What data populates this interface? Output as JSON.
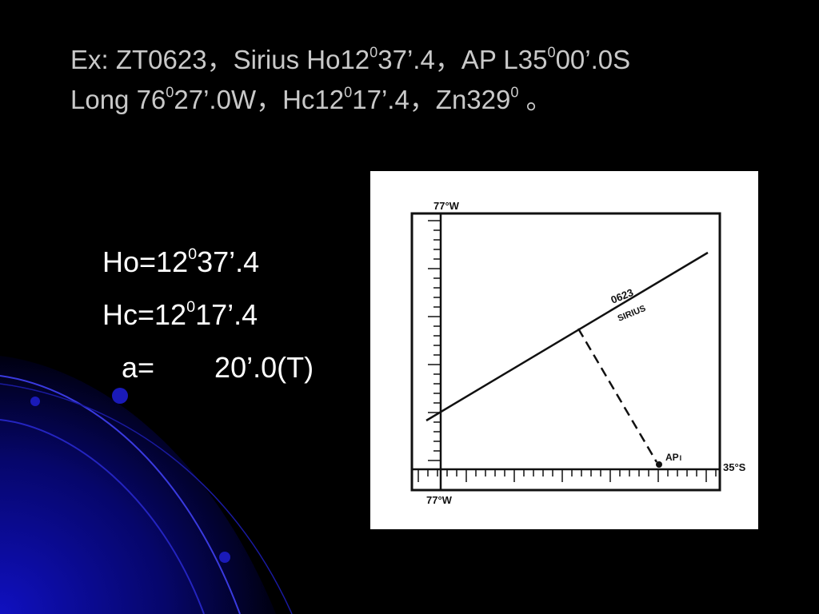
{
  "title": {
    "line1": {
      "t1": "Ex: ZT0623，Sirius Ho12",
      "s1": "0",
      "t2": "37’.4，AP L35",
      "s2": "0",
      "t3": "00’.0S"
    },
    "line2": {
      "t1": "Long 76",
      "s1": "0",
      "t2": "27’.0W，Hc12",
      "s2": "0",
      "t3": "17’.4，Zn329",
      "s3": "0",
      "t4": " 。"
    }
  },
  "equations": {
    "ho": {
      "label": "Ho=",
      "deg": "12",
      "sup": "0",
      "min": "37’.4"
    },
    "hc": {
      "label": "Hc=",
      "deg": "12",
      "sup": "0",
      "min": "17’.4"
    },
    "a": {
      "label": "a=",
      "value": "20’.0(T)"
    }
  },
  "diagram": {
    "top_label": "77°W",
    "bottom_label": "77°W",
    "right_label": "35°S",
    "lop_time": "0623",
    "lop_body": "SIRIUS",
    "ap_label": "AP",
    "ap_sub": "I"
  },
  "colors": {
    "background": "#000000",
    "title_text": "#c9c9c9",
    "body_text": "#ffffff",
    "swoosh": "#0a0a9a",
    "panel": "#ffffff",
    "ink": "#111111"
  }
}
